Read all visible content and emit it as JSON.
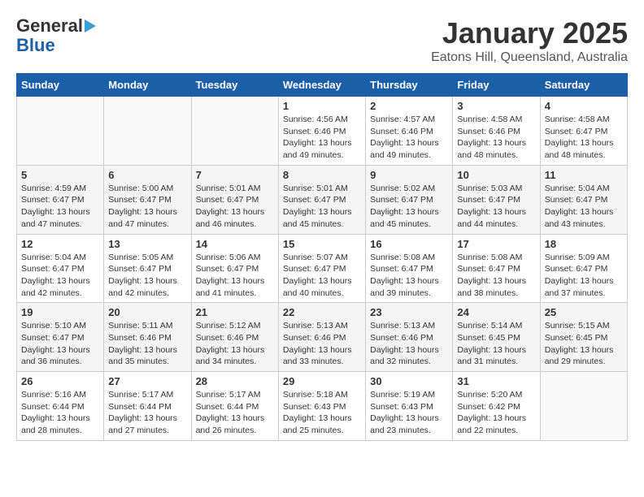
{
  "header": {
    "logo_line1": "General",
    "logo_line2": "Blue",
    "title": "January 2025",
    "subtitle": "Eatons Hill, Queensland, Australia"
  },
  "days_of_week": [
    "Sunday",
    "Monday",
    "Tuesday",
    "Wednesday",
    "Thursday",
    "Friday",
    "Saturday"
  ],
  "weeks": [
    [
      {
        "day": "",
        "info": ""
      },
      {
        "day": "",
        "info": ""
      },
      {
        "day": "",
        "info": ""
      },
      {
        "day": "1",
        "info": "Sunrise: 4:56 AM\nSunset: 6:46 PM\nDaylight: 13 hours\nand 49 minutes."
      },
      {
        "day": "2",
        "info": "Sunrise: 4:57 AM\nSunset: 6:46 PM\nDaylight: 13 hours\nand 49 minutes."
      },
      {
        "day": "3",
        "info": "Sunrise: 4:58 AM\nSunset: 6:46 PM\nDaylight: 13 hours\nand 48 minutes."
      },
      {
        "day": "4",
        "info": "Sunrise: 4:58 AM\nSunset: 6:47 PM\nDaylight: 13 hours\nand 48 minutes."
      }
    ],
    [
      {
        "day": "5",
        "info": "Sunrise: 4:59 AM\nSunset: 6:47 PM\nDaylight: 13 hours\nand 47 minutes."
      },
      {
        "day": "6",
        "info": "Sunrise: 5:00 AM\nSunset: 6:47 PM\nDaylight: 13 hours\nand 47 minutes."
      },
      {
        "day": "7",
        "info": "Sunrise: 5:01 AM\nSunset: 6:47 PM\nDaylight: 13 hours\nand 46 minutes."
      },
      {
        "day": "8",
        "info": "Sunrise: 5:01 AM\nSunset: 6:47 PM\nDaylight: 13 hours\nand 45 minutes."
      },
      {
        "day": "9",
        "info": "Sunrise: 5:02 AM\nSunset: 6:47 PM\nDaylight: 13 hours\nand 45 minutes."
      },
      {
        "day": "10",
        "info": "Sunrise: 5:03 AM\nSunset: 6:47 PM\nDaylight: 13 hours\nand 44 minutes."
      },
      {
        "day": "11",
        "info": "Sunrise: 5:04 AM\nSunset: 6:47 PM\nDaylight: 13 hours\nand 43 minutes."
      }
    ],
    [
      {
        "day": "12",
        "info": "Sunrise: 5:04 AM\nSunset: 6:47 PM\nDaylight: 13 hours\nand 42 minutes."
      },
      {
        "day": "13",
        "info": "Sunrise: 5:05 AM\nSunset: 6:47 PM\nDaylight: 13 hours\nand 42 minutes."
      },
      {
        "day": "14",
        "info": "Sunrise: 5:06 AM\nSunset: 6:47 PM\nDaylight: 13 hours\nand 41 minutes."
      },
      {
        "day": "15",
        "info": "Sunrise: 5:07 AM\nSunset: 6:47 PM\nDaylight: 13 hours\nand 40 minutes."
      },
      {
        "day": "16",
        "info": "Sunrise: 5:08 AM\nSunset: 6:47 PM\nDaylight: 13 hours\nand 39 minutes."
      },
      {
        "day": "17",
        "info": "Sunrise: 5:08 AM\nSunset: 6:47 PM\nDaylight: 13 hours\nand 38 minutes."
      },
      {
        "day": "18",
        "info": "Sunrise: 5:09 AM\nSunset: 6:47 PM\nDaylight: 13 hours\nand 37 minutes."
      }
    ],
    [
      {
        "day": "19",
        "info": "Sunrise: 5:10 AM\nSunset: 6:47 PM\nDaylight: 13 hours\nand 36 minutes."
      },
      {
        "day": "20",
        "info": "Sunrise: 5:11 AM\nSunset: 6:46 PM\nDaylight: 13 hours\nand 35 minutes."
      },
      {
        "day": "21",
        "info": "Sunrise: 5:12 AM\nSunset: 6:46 PM\nDaylight: 13 hours\nand 34 minutes."
      },
      {
        "day": "22",
        "info": "Sunrise: 5:13 AM\nSunset: 6:46 PM\nDaylight: 13 hours\nand 33 minutes."
      },
      {
        "day": "23",
        "info": "Sunrise: 5:13 AM\nSunset: 6:46 PM\nDaylight: 13 hours\nand 32 minutes."
      },
      {
        "day": "24",
        "info": "Sunrise: 5:14 AM\nSunset: 6:45 PM\nDaylight: 13 hours\nand 31 minutes."
      },
      {
        "day": "25",
        "info": "Sunrise: 5:15 AM\nSunset: 6:45 PM\nDaylight: 13 hours\nand 29 minutes."
      }
    ],
    [
      {
        "day": "26",
        "info": "Sunrise: 5:16 AM\nSunset: 6:44 PM\nDaylight: 13 hours\nand 28 minutes."
      },
      {
        "day": "27",
        "info": "Sunrise: 5:17 AM\nSunset: 6:44 PM\nDaylight: 13 hours\nand 27 minutes."
      },
      {
        "day": "28",
        "info": "Sunrise: 5:17 AM\nSunset: 6:44 PM\nDaylight: 13 hours\nand 26 minutes."
      },
      {
        "day": "29",
        "info": "Sunrise: 5:18 AM\nSunset: 6:43 PM\nDaylight: 13 hours\nand 25 minutes."
      },
      {
        "day": "30",
        "info": "Sunrise: 5:19 AM\nSunset: 6:43 PM\nDaylight: 13 hours\nand 23 minutes."
      },
      {
        "day": "31",
        "info": "Sunrise: 5:20 AM\nSunset: 6:42 PM\nDaylight: 13 hours\nand 22 minutes."
      },
      {
        "day": "",
        "info": ""
      }
    ]
  ]
}
